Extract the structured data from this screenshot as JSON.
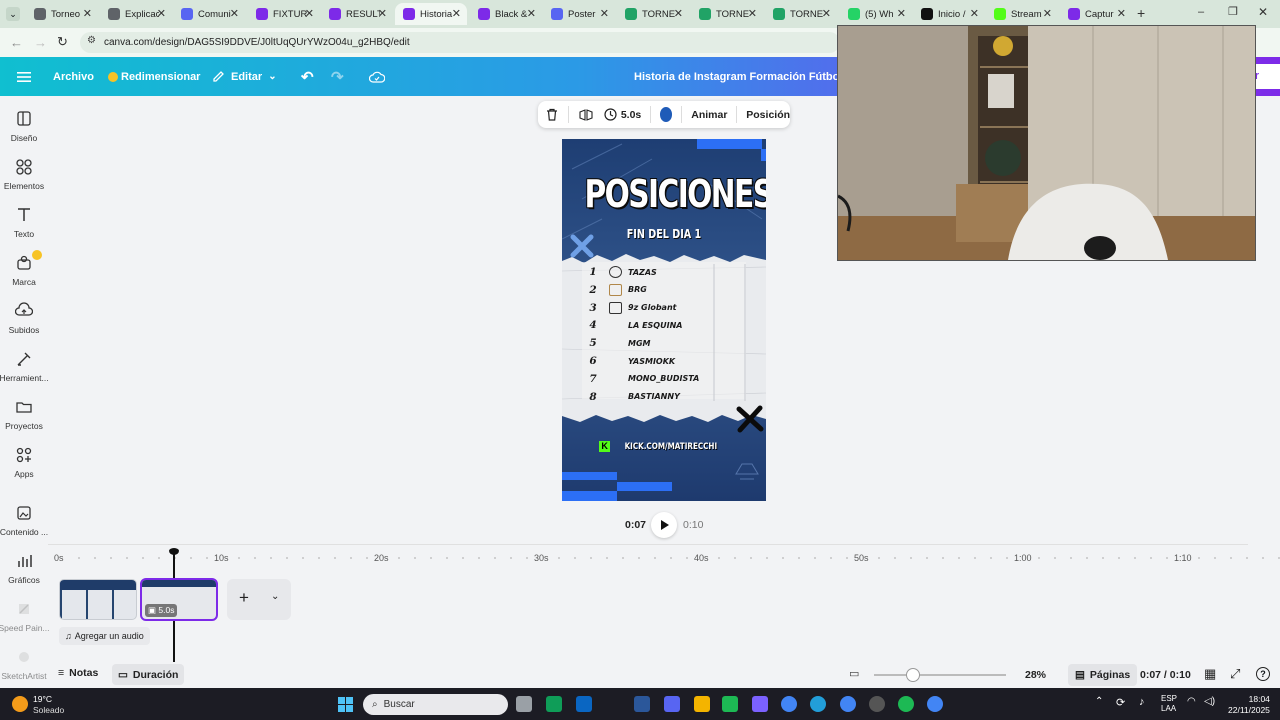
{
  "browser": {
    "tabs": [
      {
        "label": "Torneo",
        "color": "#5f6368"
      },
      {
        "label": "Explicac",
        "color": "#5f6368"
      },
      {
        "label": "Comuni",
        "color": "#5865f2"
      },
      {
        "label": "FIXTUR",
        "color": "#7d2ae8"
      },
      {
        "label": "RESULT",
        "color": "#7d2ae8"
      },
      {
        "label": "Historia",
        "color": "#7d2ae8"
      },
      {
        "label": "Black &",
        "color": "#7d2ae8"
      },
      {
        "label": "Poster",
        "color": "#5865f2"
      },
      {
        "label": "TORNE",
        "color": "#21a366"
      },
      {
        "label": "TORNE",
        "color": "#21a366"
      },
      {
        "label": "TORNE",
        "color": "#21a366"
      },
      {
        "label": "(5) Wh",
        "color": "#25d366"
      },
      {
        "label": "Inicio /",
        "color": "#111111"
      },
      {
        "label": "Stream",
        "color": "#53fc18"
      },
      {
        "label": "Captur",
        "color": "#7d2ae8"
      }
    ],
    "url": "canva.com/design/DAG5SI9DDVE/J0ltUqQUrYWzO04u_g2HBQ/edit"
  },
  "header": {
    "archivo": "Archivo",
    "redimensionar": "Redimensionar",
    "editar": "Editar",
    "title": "Historia de Instagram Formación Fútbol Final",
    "share_partial": "tir"
  },
  "sidebar": {
    "items": [
      {
        "label": "Diseño",
        "icon": "layout-icon"
      },
      {
        "label": "Elementos",
        "icon": "shapes-icon"
      },
      {
        "label": "Texto",
        "icon": "text-icon"
      },
      {
        "label": "Marca",
        "icon": "brand-icon"
      },
      {
        "label": "Subidos",
        "icon": "upload-icon"
      },
      {
        "label": "Herramient...",
        "icon": "tools-icon"
      },
      {
        "label": "Proyectos",
        "icon": "folder-icon"
      },
      {
        "label": "Apps",
        "icon": "apps-icon"
      },
      {
        "label": "Contenido ...",
        "icon": "content-icon"
      },
      {
        "label": "Gráficos",
        "icon": "chart-icon"
      },
      {
        "label": "Speed Pain...",
        "icon": "paint-icon"
      },
      {
        "label": "SketchArtist",
        "icon": "sketch-icon"
      }
    ]
  },
  "toolbar": {
    "duration": "5.0s",
    "color": "#1f5bb8",
    "animar": "Animar",
    "posicion": "Posición"
  },
  "poster": {
    "title": "POSICIONES",
    "subtitle": "FIN DEL DIA 1",
    "rows": [
      {
        "pos": "1",
        "name": "TAZAS"
      },
      {
        "pos": "2",
        "name": "BRG"
      },
      {
        "pos": "3",
        "name": "9z Globant"
      },
      {
        "pos": "4",
        "name": "LA ESQUINA"
      },
      {
        "pos": "5",
        "name": "MGM"
      },
      {
        "pos": "6",
        "name": "YASMIOKK"
      },
      {
        "pos": "7",
        "name": "MONO_BUDISTA"
      },
      {
        "pos": "8",
        "name": "BASTIANNY"
      }
    ],
    "kick": "KICK.COM/MATIRECCHI"
  },
  "player": {
    "current": "0:07",
    "total": "0:10"
  },
  "timeline": {
    "ticks": [
      "0s",
      "10s",
      "20s",
      "30s",
      "40s",
      "50s",
      "1:00",
      "1:10"
    ],
    "clip_duration": "5.0s",
    "add_audio": "Agregar un audio"
  },
  "bottom": {
    "notas": "Notas",
    "duracion": "Duración",
    "zoom": "28%",
    "paginas": "Páginas",
    "time": "0:07 / 0:10"
  },
  "taskbar": {
    "temp": "19°C",
    "weather": "Soleado",
    "search": "Buscar",
    "lang1": "ESP",
    "lang2": "LAA",
    "time": "18:04",
    "date": "22/11/2025"
  }
}
